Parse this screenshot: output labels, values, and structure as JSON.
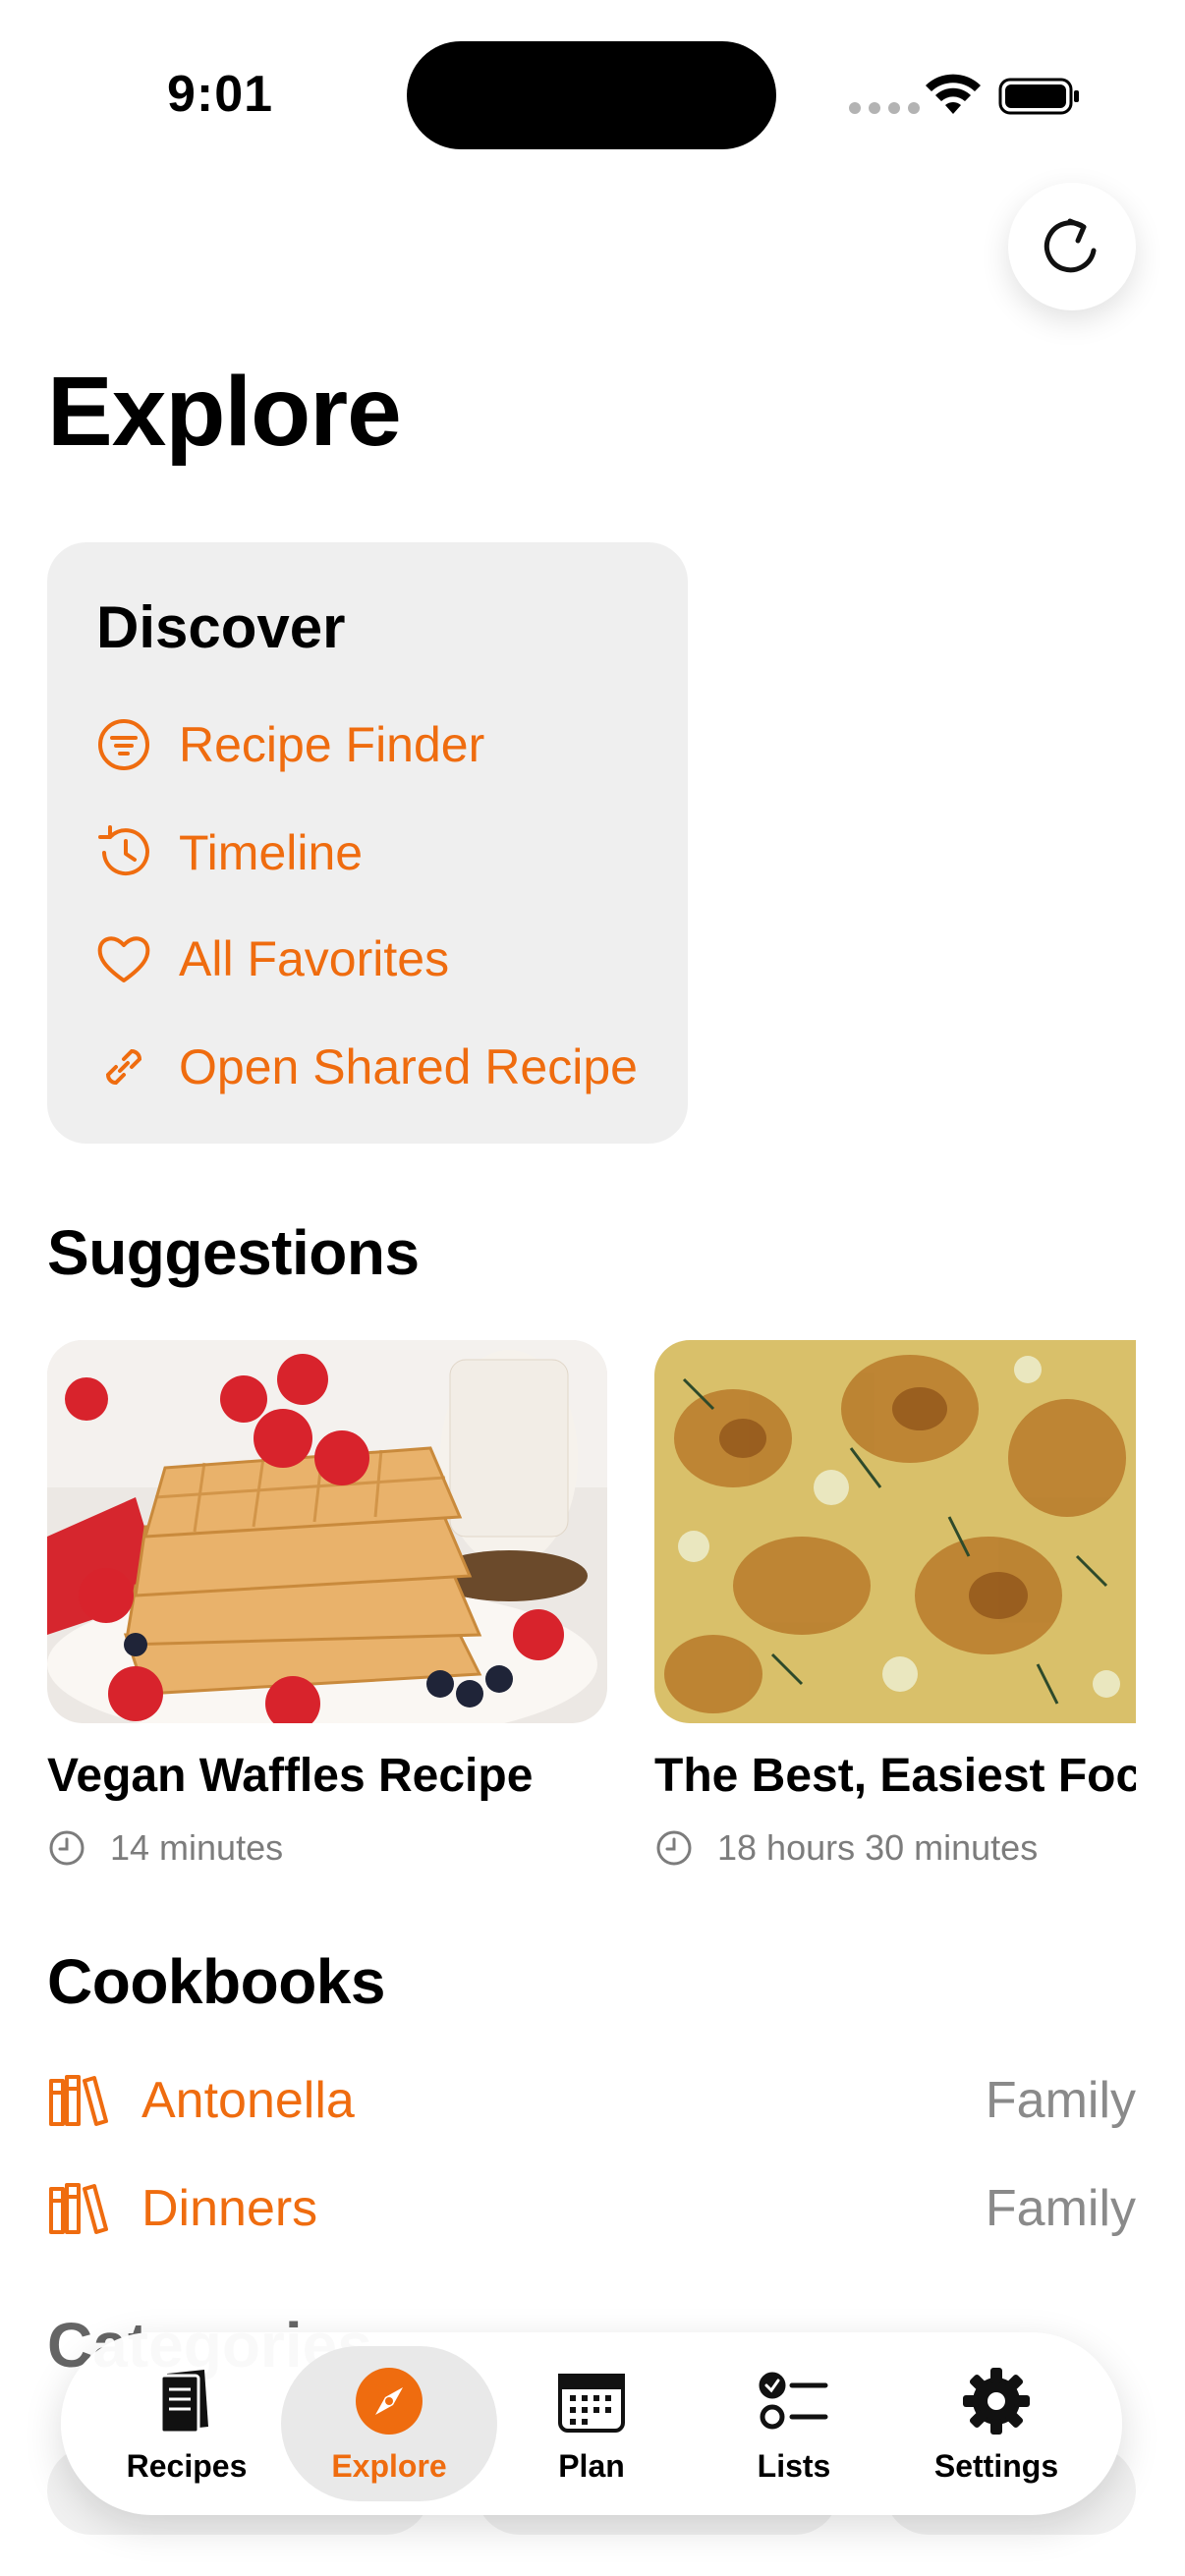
{
  "status_bar": {
    "time": "9:01"
  },
  "page": {
    "title": "Explore"
  },
  "discover": {
    "title": "Discover",
    "items": [
      {
        "label": "Recipe Finder",
        "icon": "filter-icon"
      },
      {
        "label": "Timeline",
        "icon": "history-clock-icon"
      },
      {
        "label": "All Favorites",
        "icon": "heart-icon"
      },
      {
        "label": "Open Shared Recipe",
        "icon": "link-icon"
      }
    ]
  },
  "suggestions": {
    "title": "Suggestions",
    "cards": [
      {
        "title": "Vegan Waffles Recipe",
        "time": "14 minutes"
      },
      {
        "title": "The Best, Easiest Focaccia",
        "time": "18 hours 30 minutes"
      }
    ]
  },
  "cookbooks": {
    "title": "Cookbooks",
    "items": [
      {
        "name": "Antonella",
        "tag": "Family"
      },
      {
        "name": "Dinners",
        "tag": "Family"
      }
    ]
  },
  "categories": {
    "title": "Categories"
  },
  "tabbar": {
    "tabs": [
      {
        "label": "Recipes",
        "icon": "recipe-book-icon"
      },
      {
        "label": "Explore",
        "icon": "compass-icon",
        "active": true
      },
      {
        "label": "Plan",
        "icon": "calendar-icon"
      },
      {
        "label": "Lists",
        "icon": "checklist-icon"
      },
      {
        "label": "Settings",
        "icon": "gear-icon"
      }
    ]
  },
  "colors": {
    "accent": "#ef6c0f",
    "card_bg": "#efefef",
    "secondary_text": "#7c7c7c"
  }
}
